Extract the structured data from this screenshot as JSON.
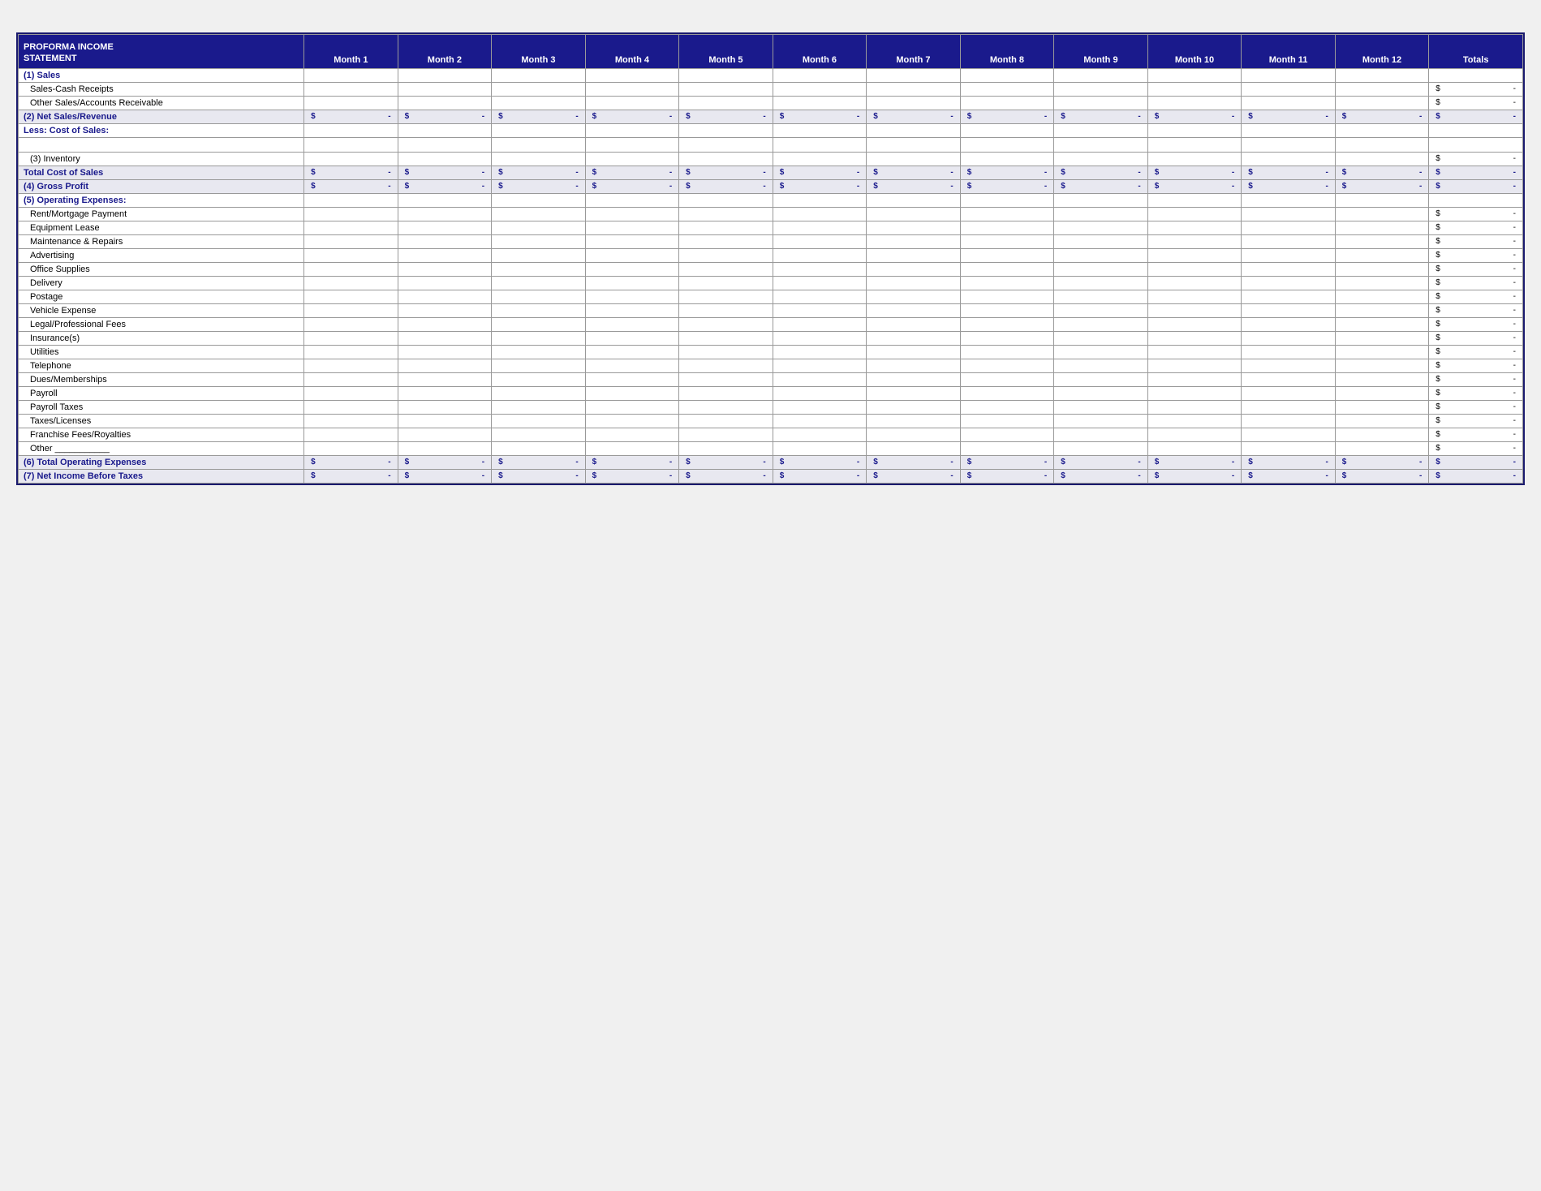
{
  "title": {
    "line1": "PROFORMA INCOME",
    "line2": "STATEMENT"
  },
  "columns": [
    "Month 1",
    "Month 2",
    "Month 3",
    "Month 4",
    "Month 5",
    "Month 6",
    "Month 7",
    "Month 8",
    "Month 9",
    "Month 10",
    "Month 11",
    "Month 12",
    "Totals"
  ],
  "rows": [
    {
      "type": "section",
      "label": "(1) Sales"
    },
    {
      "type": "sub",
      "label": "Sales-Cash Receipts",
      "hasTotal": true
    },
    {
      "type": "sub",
      "label": "Other Sales/Accounts Receivable",
      "hasTotal": true
    },
    {
      "type": "summary",
      "label": "(2) Net Sales/Revenue",
      "hasMoney": true
    },
    {
      "type": "section",
      "label": "Less: Cost of Sales:"
    },
    {
      "type": "empty"
    },
    {
      "type": "sub",
      "label": "(3) Inventory",
      "hasTotal": true
    },
    {
      "type": "summary",
      "label": "Total Cost of Sales",
      "hasMoney": true
    },
    {
      "type": "summary",
      "label": "(4) Gross Profit",
      "hasMoney": true
    },
    {
      "type": "section",
      "label": "(5) Operating Expenses:"
    },
    {
      "type": "sub",
      "label": "Rent/Mortgage Payment",
      "hasTotal": true
    },
    {
      "type": "sub",
      "label": "Equipment Lease",
      "hasTotal": true
    },
    {
      "type": "sub",
      "label": "Maintenance & Repairs",
      "hasTotal": true
    },
    {
      "type": "sub",
      "label": "Advertising",
      "hasTotal": true
    },
    {
      "type": "sub",
      "label": "Office Supplies",
      "hasTotal": true
    },
    {
      "type": "sub",
      "label": "Delivery",
      "hasTotal": true
    },
    {
      "type": "sub",
      "label": "Postage",
      "hasTotal": true
    },
    {
      "type": "sub",
      "label": "Vehicle Expense",
      "hasTotal": true
    },
    {
      "type": "sub",
      "label": "Legal/Professional Fees",
      "hasTotal": true
    },
    {
      "type": "sub",
      "label": "Insurance(s)",
      "hasTotal": true
    },
    {
      "type": "sub",
      "label": "Utilities",
      "hasTotal": true
    },
    {
      "type": "sub",
      "label": "Telephone",
      "hasTotal": true
    },
    {
      "type": "sub",
      "label": "Dues/Memberships",
      "hasTotal": true
    },
    {
      "type": "sub",
      "label": "Payroll",
      "hasTotal": true
    },
    {
      "type": "sub",
      "label": "Payroll Taxes",
      "hasTotal": true
    },
    {
      "type": "sub",
      "label": "Taxes/Licenses",
      "hasTotal": true
    },
    {
      "type": "sub",
      "label": "Franchise Fees/Royalties",
      "hasTotal": true
    },
    {
      "type": "sub",
      "label": "Other ___________",
      "hasTotal": true
    },
    {
      "type": "summary",
      "label": "(6) Total Operating Expenses",
      "hasMoney": true
    },
    {
      "type": "summary",
      "label": "(7) Net Income Before Taxes",
      "hasMoney": true
    }
  ]
}
